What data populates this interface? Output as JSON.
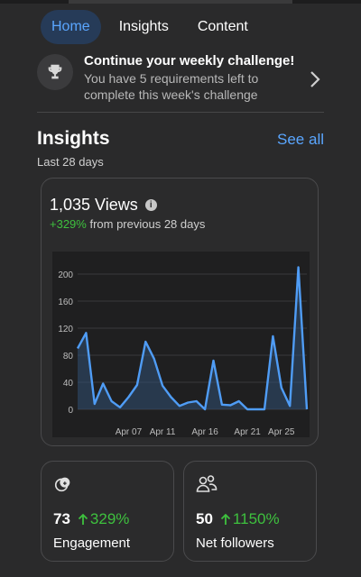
{
  "tabs": [
    {
      "label": "Home",
      "active": true
    },
    {
      "label": "Insights",
      "active": false
    },
    {
      "label": "Content",
      "active": false
    }
  ],
  "challenge": {
    "title": "Continue your weekly challenge!",
    "subtitle": "You have 5 requirements left to complete this week's challenge",
    "icon": "trophy-icon"
  },
  "insights": {
    "title": "Insights",
    "see_all": "See all",
    "period": "Last 28 days"
  },
  "views_card": {
    "title": "1,035 Views",
    "change_pct": "+329%",
    "change_text": " from previous 28 days"
  },
  "chart_data": {
    "type": "area",
    "x_ticks": [
      "Apr 07",
      "Apr 11",
      "Apr 16",
      "Apr 21",
      "Apr 25"
    ],
    "y_ticks": [
      "0",
      "40",
      "80",
      "120",
      "160",
      "200"
    ],
    "ylim": [
      0,
      220
    ],
    "series": [
      {
        "values": [
          90,
          113,
          8,
          38,
          12,
          3,
          18,
          36,
          100,
          75,
          35,
          18,
          5,
          10,
          12,
          0,
          72,
          7,
          6,
          12,
          0,
          0,
          0,
          108,
          32,
          5,
          210,
          0
        ]
      }
    ],
    "color": "#4f9cf5"
  },
  "engagement": {
    "value": "73",
    "change": "329%",
    "label": "Engagement",
    "icon": "engagement-icon"
  },
  "followers": {
    "value": "50",
    "change": "1150%",
    "label": "Net followers",
    "icon": "people-icon"
  }
}
